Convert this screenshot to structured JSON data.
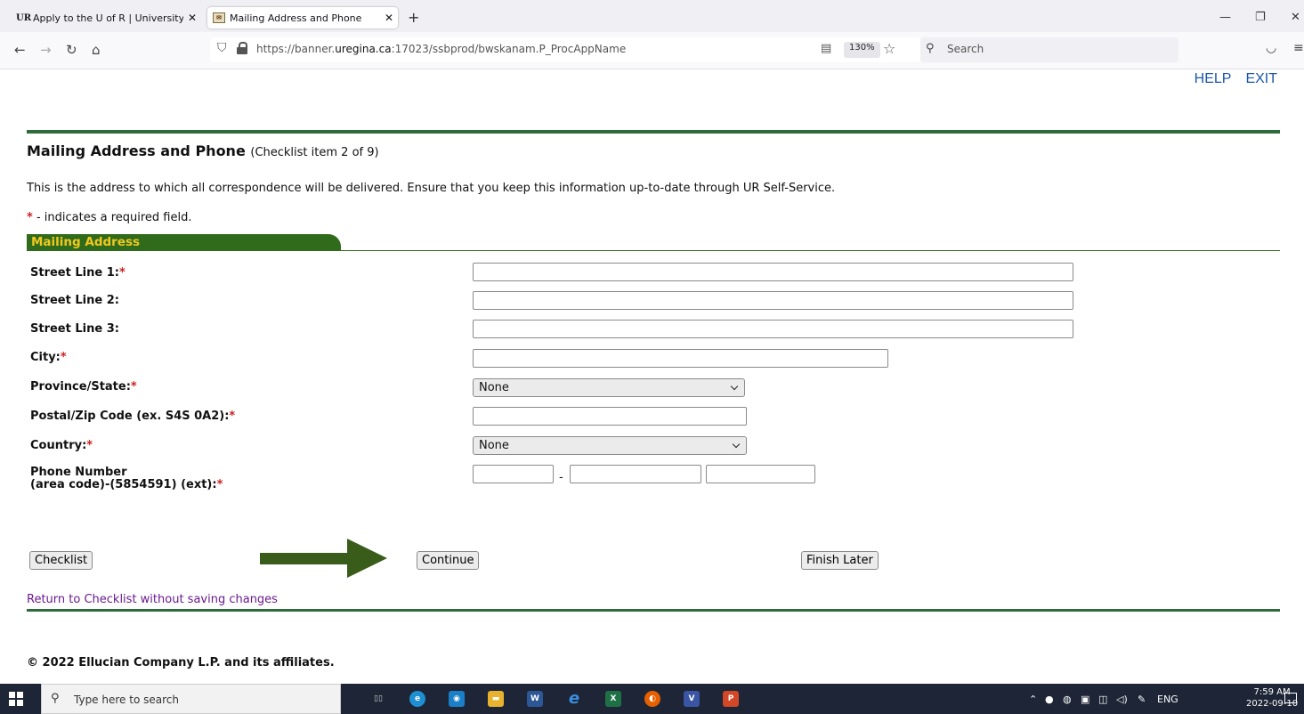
{
  "browser": {
    "tabs": [
      {
        "title": "Apply to the U of R | University",
        "favicon": "UR-logo",
        "active": false
      },
      {
        "title": "Mailing Address and Phone",
        "favicon": "envelope-logo",
        "active": true
      }
    ],
    "url_prefix": "https://banner.",
    "url_domain": "uregina.ca",
    "url_suffix": ":17023/ssbprod/bwskanam.P_ProcAppName",
    "zoom": "130%",
    "search_placeholder": "Search"
  },
  "header": {
    "help": "HELP",
    "exit": "EXIT"
  },
  "page": {
    "title": "Mailing Address and Phone",
    "subtitle": "(Checklist item 2 of 9)",
    "intro": "This is the address to which all correspondence will be delivered. Ensure that you keep this information up-to-date through UR Self-Service.",
    "required_symbol": "*",
    "required_note": " - indicates a required field."
  },
  "section": {
    "title": "Mailing Address"
  },
  "form": {
    "street1": {
      "label": "Street Line 1:",
      "value": ""
    },
    "street2": {
      "label": "Street Line 2:",
      "value": ""
    },
    "street3": {
      "label": "Street Line 3:",
      "value": ""
    },
    "city": {
      "label": "City:",
      "value": ""
    },
    "province": {
      "label": "Province/State:",
      "selected": "None"
    },
    "postal": {
      "label": "Postal/Zip Code (ex. S4S 0A2):",
      "value": ""
    },
    "country": {
      "label": "Country:",
      "selected": "None"
    },
    "phone": {
      "label_line1": "Phone Number",
      "label_line2": "(area code)-(5854591) (ext):",
      "separator": "-",
      "area": "",
      "number": "",
      "ext": ""
    }
  },
  "buttons": {
    "checklist": "Checklist",
    "continue": "Continue",
    "finish_later": "Finish Later"
  },
  "return_link": "Return to Checklist without saving changes",
  "copyright": "© 2022 Ellucian Company L.P. and its affiliates.",
  "colors": {
    "brand_green": "#2e6b3a",
    "section_gold": "#f2c81f",
    "required_red": "#cc1f1f",
    "arrow_green": "#3a5c1a"
  },
  "taskbar": {
    "search_placeholder": "Type here to search",
    "language": "ENG",
    "time": "7:59 AM",
    "date": "2022-09-10"
  }
}
